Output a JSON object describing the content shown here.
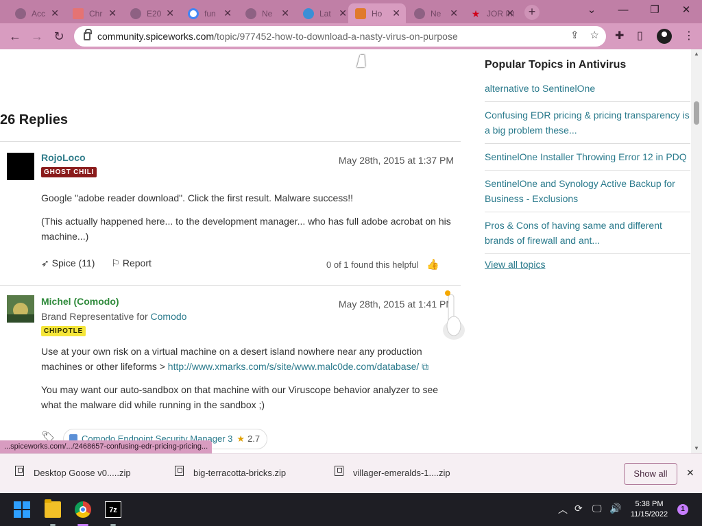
{
  "tabs": [
    {
      "label": "Acc",
      "icon": "globe-icon"
    },
    {
      "label": "Chr",
      "icon": "calendar-icon"
    },
    {
      "label": "E20",
      "icon": "globe-icon"
    },
    {
      "label": "fun",
      "icon": "google-icon"
    },
    {
      "label": "Ne",
      "icon": "globe-icon"
    },
    {
      "label": "Lat",
      "icon": "earth-icon"
    },
    {
      "label": "Ho",
      "icon": "spiceworks-icon",
      "active": true
    },
    {
      "label": "Ne",
      "icon": "globe-icon"
    },
    {
      "label": "JOR Int",
      "icon": "star-icon"
    }
  ],
  "toolbar": {
    "url_host": "community.spiceworks.com",
    "url_path": "/topic/977452-how-to-download-a-nasty-virus-on-purpose"
  },
  "content": {
    "replies_title": "26 Replies",
    "post1": {
      "username": "RojoLoco",
      "badge": "GHOST CHILI",
      "date": "May 28th, 2015 at 1:37 PM",
      "para1": "Google \"adobe reader download\".  Click the first result.  Malware success!!",
      "para2": "(This actually happened here... to the development manager... who has full adobe acrobat on his machine...)",
      "spice_label": "Spice (11)",
      "report_label": "Report",
      "helpful_text": "0 of 1 found this helpful"
    },
    "post2": {
      "username": "Michel (Comodo)",
      "rep_prefix": "Brand Representative for",
      "rep_company": "Comodo",
      "badge": "CHIPOTLE",
      "date": "May 28th, 2015 at 1:41 PM",
      "para1_text": "Use at your own risk on a virtual machine on a desert island nowhere near any production machines or other lifeforms >",
      "para1_link": "http://www.xmarks.com/s/site/www.malc0de.com/database/",
      "para2": "You may want our auto-sandbox on that machine with our Viruscope behavior analyzer to see what the malware did while running in the sandbox ;)",
      "product_name": "Comodo Endpoint Security Manager 3",
      "product_rating": "2.7"
    }
  },
  "sidebar": {
    "title": "Popular Topics in Antivirus",
    "topics": [
      "alternative to SentinelOne",
      "Confusing EDR pricing & pricing transparency is a big problem these...",
      "SentinelOne Installer Throwing Error 12 in PDQ",
      "SentinelOne and Synology Active Backup for Business - Exclusions",
      "Pros & Cons of having same and different brands of firewall and ant..."
    ],
    "view_all": "View all topics"
  },
  "status_url": "...spiceworks.com/.../2468657-confusing-edr-pricing-pricing...",
  "downloads": {
    "items": [
      "Desktop Goose v0.....zip",
      "big-terracotta-bricks.zip",
      "villager-emeralds-1....zip"
    ],
    "show_all": "Show all"
  },
  "taskbar": {
    "time": "5:38 PM",
    "date": "11/15/2022",
    "notification_count": "1"
  },
  "colors": {
    "chrome_frame": "#c07fa6",
    "link": "#2a7a8c",
    "ghost_chili_badge": "#8a1b1b",
    "chipotle_badge": "#f5e63a"
  }
}
